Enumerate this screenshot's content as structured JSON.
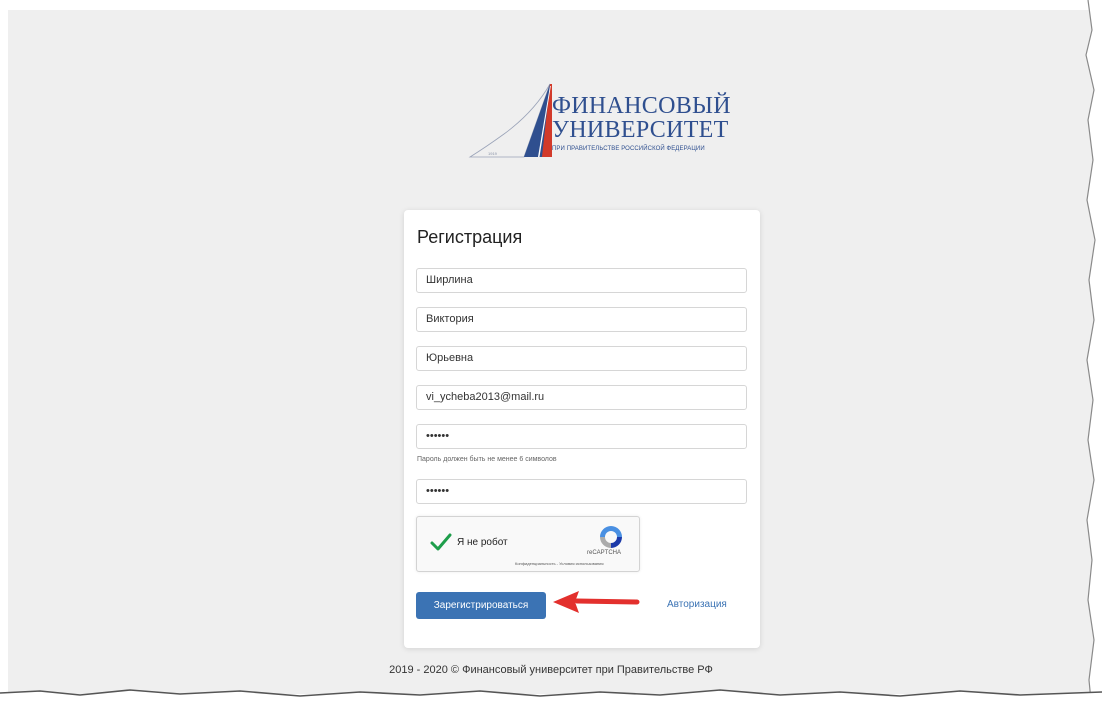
{
  "logo": {
    "line1": "ФИНАНСОВЫЙ",
    "line2": "УНИВЕРСИТЕТ",
    "subtitle": "ПРИ ПРАВИТЕЛЬСТВЕ РОССИЙСКОЙ ФЕДЕРАЦИИ",
    "year": "1919"
  },
  "form": {
    "title": "Регистрация",
    "fields": {
      "last_name": "Ширлина",
      "first_name": "Виктория",
      "middle_name": "Юрьевна",
      "email": "vi_ycheba2013@mail.ru",
      "password": "••••••",
      "password_confirm": "••••••"
    },
    "password_hint": "Пароль должен быть не менее 6 символов",
    "captcha": {
      "label": "Я не робот",
      "brand": "reCAPTCHA",
      "links": "Конфиденциальность - Условия использования"
    },
    "submit_label": "Зарегистрироваться",
    "auth_link": "Авторизация"
  },
  "footer": {
    "text": "2019 - 2020 © Финансовый университет при Правительстве РФ"
  },
  "colors": {
    "accent": "#3b73b4",
    "arrow": "#e3302d",
    "check": "#1e9e4b",
    "logo_blue": "#2f4f8f",
    "logo_red": "#d23a2a"
  }
}
